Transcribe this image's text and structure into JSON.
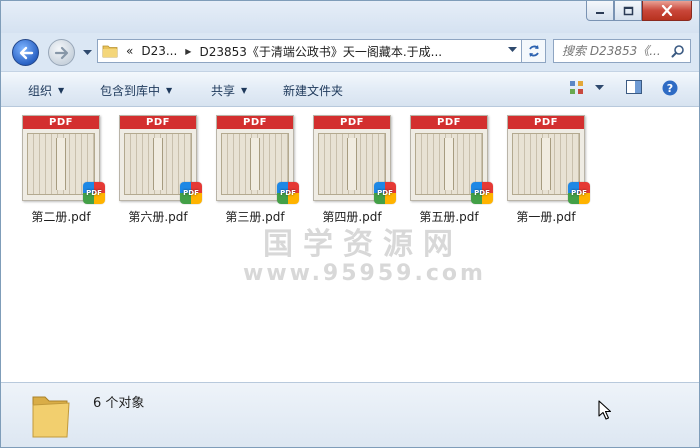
{
  "window": {
    "controls": {
      "minimize": "minimize",
      "maximize": "maximize",
      "close": "close"
    }
  },
  "nav": {
    "back": "back",
    "forward": "forward"
  },
  "address": {
    "chevrons": "«",
    "root": "D23...",
    "path": "D23853《于清端公政书》天一阁藏本.于成..."
  },
  "search": {
    "placeholder": "搜索 D23853《..."
  },
  "toolbar": {
    "organize": "组织",
    "include_library": "包含到库中",
    "share": "共享",
    "new_folder": "新建文件夹"
  },
  "files": [
    {
      "name": "第二册.pdf",
      "banner": "PDF",
      "badge": "PDF"
    },
    {
      "name": "第六册.pdf",
      "banner": "PDF",
      "badge": "PDF"
    },
    {
      "name": "第三册.pdf",
      "banner": "PDF",
      "badge": "PDF"
    },
    {
      "name": "第四册.pdf",
      "banner": "PDF",
      "badge": "PDF"
    },
    {
      "name": "第五册.pdf",
      "banner": "PDF",
      "badge": "PDF"
    },
    {
      "name": "第一册.pdf",
      "banner": "PDF",
      "badge": "PDF"
    }
  ],
  "watermark": {
    "line1": "国学资源网",
    "line2": "www.95959.com"
  },
  "details": {
    "count_text": "6 个对象"
  },
  "colors": {
    "pdf_banner": "#d32f2f",
    "accent": "#2a62c4"
  }
}
